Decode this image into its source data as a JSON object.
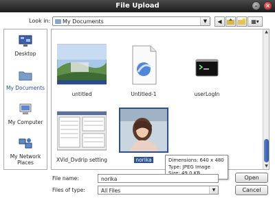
{
  "window": {
    "title": "File Upload"
  },
  "toolbar": {
    "look_in_label": "Look in:",
    "location": "My Documents"
  },
  "places": [
    {
      "label": "Desktop",
      "icon": "desktop-icon"
    },
    {
      "label": "My Documents",
      "icon": "folder-icon",
      "selected": true
    },
    {
      "label": "My Computer",
      "icon": "computer-icon"
    },
    {
      "label": "My Network Places",
      "icon": "network-icon"
    }
  ],
  "files": [
    {
      "name": "untitled"
    },
    {
      "name": "Untitled-1"
    },
    {
      "name": "userLogIn"
    },
    {
      "name": "XVid_Dvdrip setting"
    },
    {
      "name": "norika",
      "selected": true
    }
  ],
  "tooltip": {
    "dimensions": "Dimensions: 640 x 480",
    "type": "Type: JPEG Image",
    "size": "Size: 49.0 KB"
  },
  "footer": {
    "file_name_label": "File name:",
    "file_name_value": "norika",
    "file_type_label": "Files of type:",
    "file_type_value": "All Files",
    "open_label": "Open",
    "cancel_label": "Cancel"
  },
  "colors": {
    "selection": "#2a4f93",
    "titlebar": "#2a2a2a"
  }
}
